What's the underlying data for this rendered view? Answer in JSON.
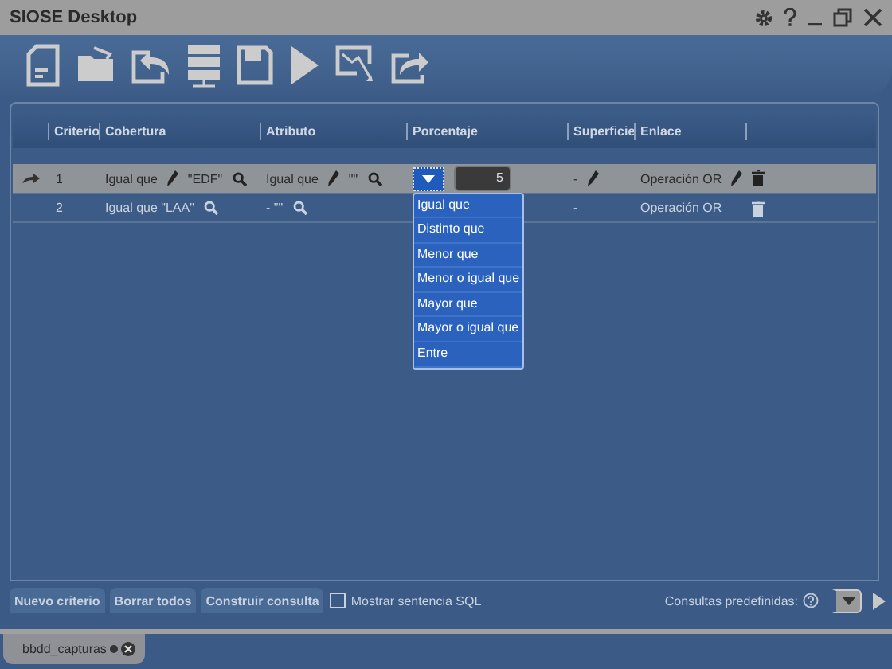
{
  "window": {
    "title": "SIOSE Desktop"
  },
  "table": {
    "columns": [
      "Criterio",
      "Cobertura",
      "Atributo",
      "Porcentaje",
      "Superficie",
      "Enlace"
    ],
    "rows": [
      {
        "selected": true,
        "criterio": "1",
        "cobertura": [
          {
            "kind": "text",
            "text": "Igual que"
          },
          {
            "kind": "edit"
          },
          {
            "kind": "text",
            "text": "\"EDF\""
          },
          {
            "kind": "search"
          }
        ],
        "atributo": [
          {
            "kind": "text",
            "text": "Igual que"
          },
          {
            "kind": "edit"
          },
          {
            "kind": "text",
            "text": "\"\""
          },
          {
            "kind": "search"
          }
        ],
        "porcentaje": [
          {
            "kind": "dropdown",
            "expanded": true,
            "options": [
              {
                "label": "Igual que",
                "selected": false
              },
              {
                "label": "Distinto que",
                "selected": false
              },
              {
                "label": "Menor que",
                "selected": false
              },
              {
                "label": "Menor o igual que",
                "selected": false
              },
              {
                "label": "Mayor que",
                "selected": false
              },
              {
                "label": "Mayor o igual que",
                "selected": false
              },
              {
                "label": "Entre",
                "selected": false
              }
            ]
          },
          {
            "kind": "input",
            "value": "5"
          }
        ],
        "superficie": [
          {
            "kind": "text",
            "text": "-"
          },
          {
            "kind": "edit"
          }
        ],
        "enlace": [
          {
            "kind": "text",
            "text": "Operación OR"
          },
          {
            "kind": "edit"
          }
        ]
      },
      {
        "selected": false,
        "criterio": "2",
        "cobertura": [
          {
            "kind": "text",
            "text": "Igual que \"LAA\""
          },
          {
            "kind": "search"
          }
        ],
        "atributo": [
          {
            "kind": "text",
            "text": "- \"\""
          },
          {
            "kind": "search"
          }
        ],
        "porcentaje": [],
        "superficie": [
          {
            "kind": "text",
            "text": "-"
          }
        ],
        "enlace": [
          {
            "kind": "text",
            "text": "Operación OR"
          }
        ]
      }
    ]
  },
  "buttons": [
    "Nuevo criterio",
    "Borrar todos",
    "Construir consulta"
  ],
  "show_sql": {
    "label": "Mostrar sentencia SQL",
    "checked": false
  },
  "predefined": {
    "label": "Consultas predefinidas:"
  },
  "tabs": [
    {
      "label": "bbdd_capturas",
      "modified": true
    }
  ]
}
